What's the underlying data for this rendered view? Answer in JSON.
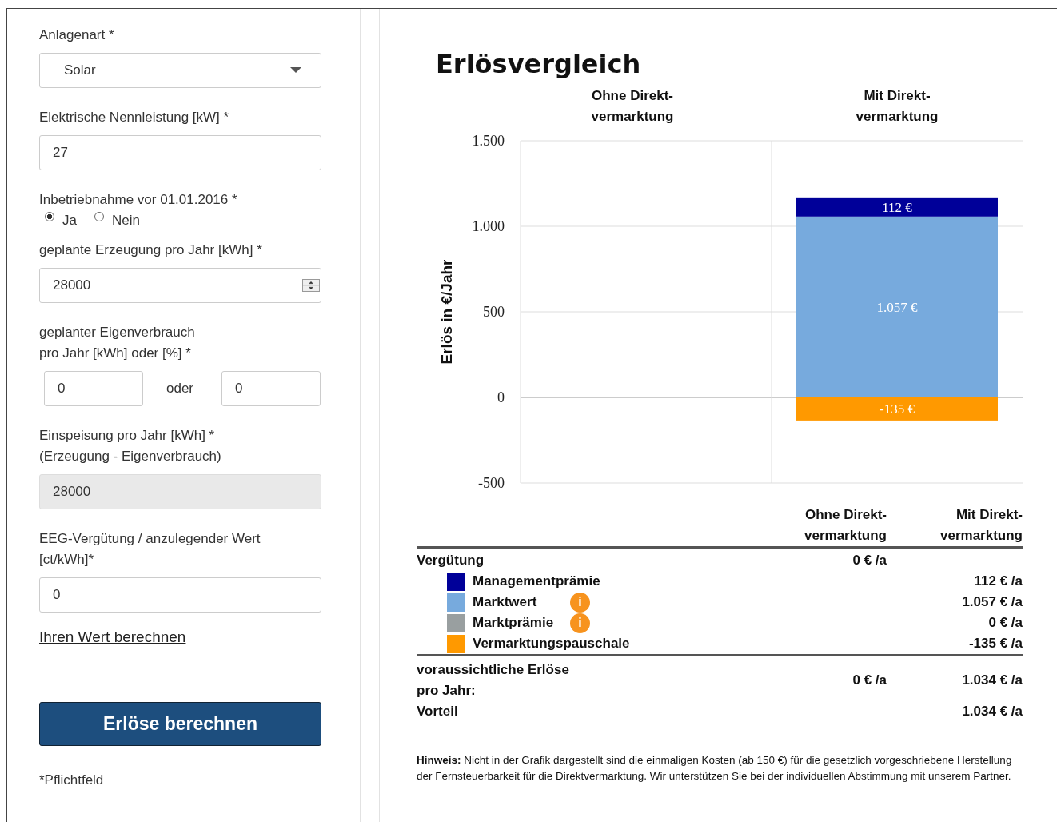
{
  "form": {
    "fields": [
      {
        "kind": "select",
        "label": "Anlagenart *",
        "value": "Solar"
      },
      {
        "kind": "text",
        "label": "Elektrische Nennleistung [kW] *",
        "value": "27"
      },
      {
        "kind": "radio",
        "label": "Inbetriebnahme vor 01.01.2016 *",
        "options": [
          {
            "label": "Ja",
            "selected": true
          },
          {
            "label": "Nein",
            "selected": false
          }
        ]
      },
      {
        "kind": "number",
        "label": "geplante Erzeugung pro Jahr [kWh] *",
        "value": "28000"
      },
      {
        "kind": "pair",
        "label": "geplanter Eigenverbrauch\npro Jahr [kWh] oder [%] *",
        "value": "0",
        "separator": "oder",
        "value_2": "0"
      },
      {
        "kind": "readonly",
        "label": "Einspeisung pro Jahr [kWh] *\n(Erzeugung - Eigenverbrauch)",
        "value": "28000"
      },
      {
        "kind": "text",
        "label": "EEG-Vergütung / anzulegender Wert\n[ct/kWh]*",
        "value": "0"
      }
    ],
    "link": "Ihren Wert berechnen",
    "submit_button": "Erlöse berechnen",
    "footnote": "*Pflichtfeld"
  },
  "result": {
    "title": "Erlösvergleich",
    "chart_data": {
      "type": "bar",
      "stacked": true,
      "ylabel": "Erlös in €/Jahr",
      "categories": [
        "Ohne Direkt-\nvermarktung",
        "Mit Direkt-\nvermarktung"
      ],
      "ylim": [
        -500,
        1500
      ],
      "yticks": [
        {
          "value": -500,
          "label": "-500"
        },
        {
          "value": 0,
          "label": "0"
        },
        {
          "value": 500,
          "label": "500"
        },
        {
          "value": 1000,
          "label": "1.000"
        },
        {
          "value": 1500,
          "label": "1.500"
        }
      ],
      "series": [
        {
          "name": "Managementprämie",
          "color": "#000099",
          "values": [
            0,
            112
          ]
        },
        {
          "name": "Marktwert",
          "color": "#77aadd",
          "values": [
            0,
            1057
          ]
        },
        {
          "name": "Marktprämie",
          "color": "#999fa0",
          "values": [
            0,
            0
          ]
        },
        {
          "name": "Vermarktungspauschale",
          "color": "#ff9900",
          "values": [
            0,
            -135
          ]
        }
      ],
      "value_labels": [
        [
          null,
          "112 €"
        ],
        [
          null,
          "1.057 €"
        ],
        [
          null,
          null
        ],
        [
          null,
          "-135 €"
        ]
      ]
    },
    "table": {
      "columns": [
        "Ohne Direkt-\nvermarktung",
        "Mit Direkt-\nvermarktung"
      ],
      "rows": [
        {
          "kind": "group",
          "label": "Vergütung",
          "value_1": "0 € /a"
        },
        {
          "kind": "legend",
          "value_2": "112 € /a"
        },
        {
          "kind": "legend",
          "info": "i",
          "value_2": "1.057 € /a"
        },
        {
          "kind": "legend",
          "info": "i",
          "value_2": "0 € /a"
        },
        {
          "kind": "legend",
          "value_2": "-135 € /a"
        },
        {
          "kind": "total",
          "label": "voraussichtliche Erlöse\npro Jahr:",
          "value_1": "0 € /a",
          "value_2": "1.034 € /a"
        },
        {
          "kind": "total",
          "label": "Vorteil",
          "value_2": "1.034 € /a"
        }
      ]
    },
    "note": "**Hinweis:** Nicht in der Grafik dargestellt sind die einmaligen Kosten (ab 150 €) für die gesetzlich vorgeschriebene Herstellung der Fernsteuerbarkeit für die Direktvermarktung. Wir unterstützen Sie bei der individuellen Abstimmung mit unserem Partner."
  }
}
